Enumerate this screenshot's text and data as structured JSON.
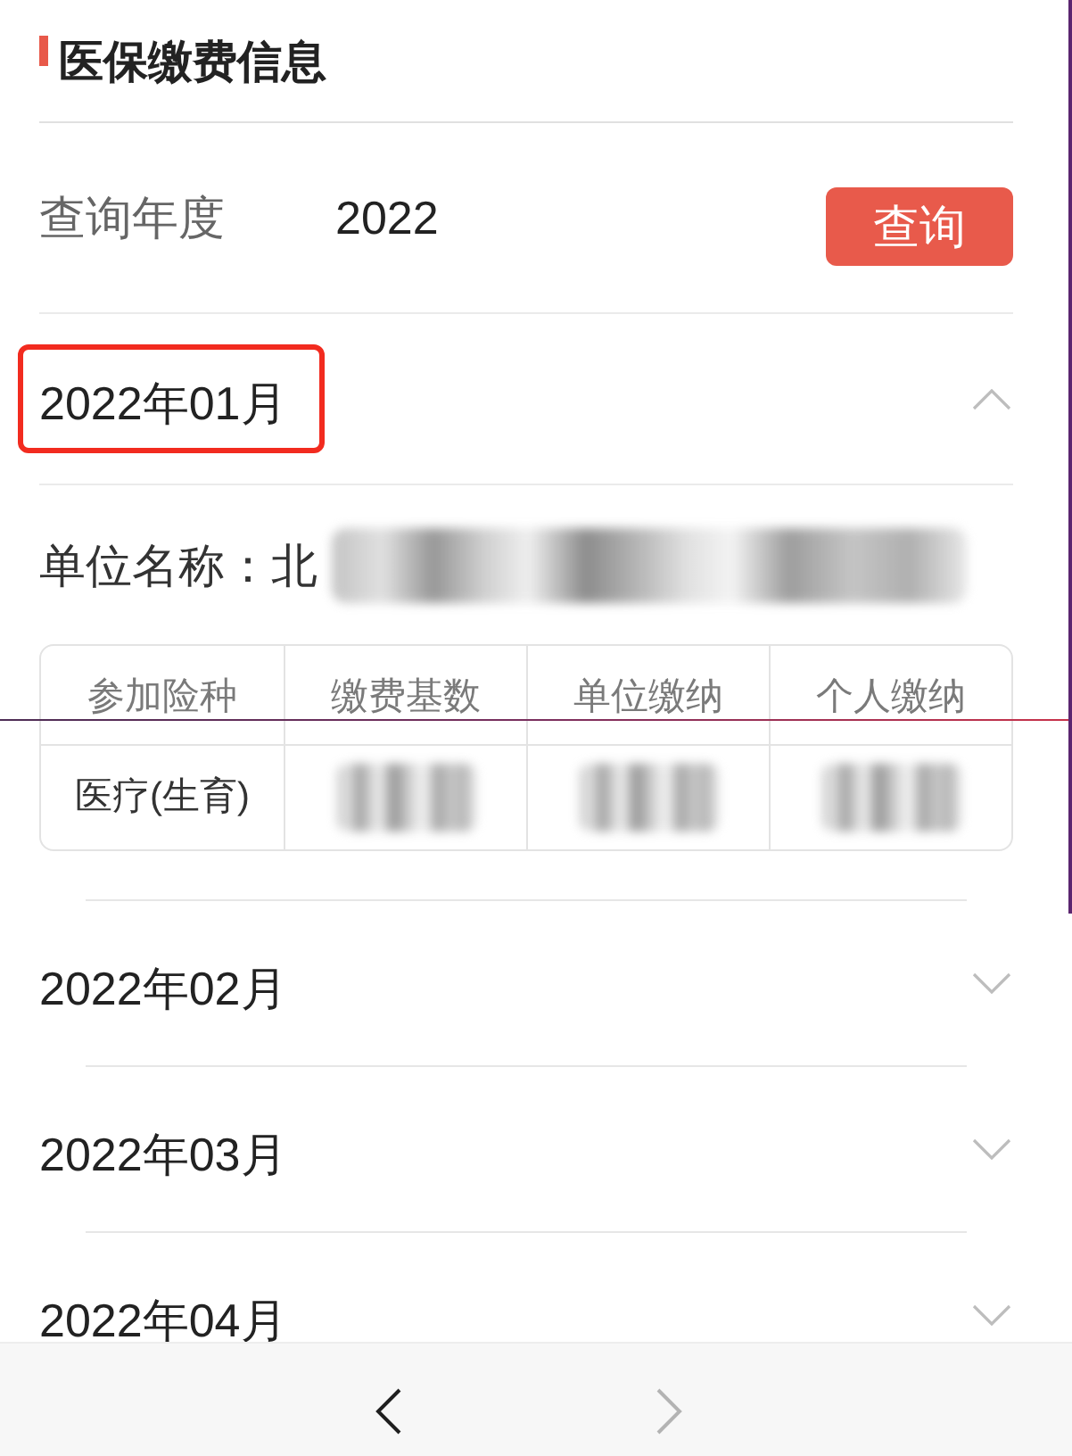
{
  "section": {
    "title": "医保缴费信息"
  },
  "query": {
    "label": "查询年度",
    "year": "2022",
    "button": "查询"
  },
  "months": [
    {
      "label": "2022年01月",
      "expanded": true,
      "highlighted": true,
      "detail": {
        "company": {
          "label": "单位名称：",
          "value": "北",
          "value_redacted": true
        },
        "table": {
          "columns": [
            "参加险种",
            "缴费基数",
            "单位缴纳",
            "个人缴纳"
          ],
          "rows": [
            [
              {
                "text": "医疗(生育)",
                "redacted": false
              },
              {
                "redacted": true
              },
              {
                "redacted": true
              },
              {
                "redacted": true
              }
            ]
          ]
        }
      }
    },
    {
      "label": "2022年02月",
      "expanded": false,
      "highlighted": false
    },
    {
      "label": "2022年03月",
      "expanded": false,
      "highlighted": false
    },
    {
      "label": "2022年04月",
      "expanded": false,
      "highlighted": false
    }
  ],
  "toolbar": {
    "back": {
      "disabled": false
    },
    "forward": {
      "disabled": true
    }
  }
}
